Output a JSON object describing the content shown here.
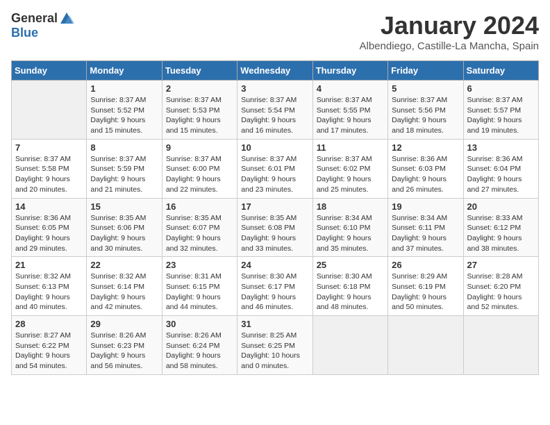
{
  "header": {
    "logo_general": "General",
    "logo_blue": "Blue",
    "title": "January 2024",
    "subtitle": "Albendiego, Castille-La Mancha, Spain"
  },
  "weekdays": [
    "Sunday",
    "Monday",
    "Tuesday",
    "Wednesday",
    "Thursday",
    "Friday",
    "Saturday"
  ],
  "weeks": [
    [
      {
        "day": "",
        "empty": true
      },
      {
        "day": "1",
        "sunrise": "Sunrise: 8:37 AM",
        "sunset": "Sunset: 5:52 PM",
        "daylight": "Daylight: 9 hours and 15 minutes."
      },
      {
        "day": "2",
        "sunrise": "Sunrise: 8:37 AM",
        "sunset": "Sunset: 5:53 PM",
        "daylight": "Daylight: 9 hours and 15 minutes."
      },
      {
        "day": "3",
        "sunrise": "Sunrise: 8:37 AM",
        "sunset": "Sunset: 5:54 PM",
        "daylight": "Daylight: 9 hours and 16 minutes."
      },
      {
        "day": "4",
        "sunrise": "Sunrise: 8:37 AM",
        "sunset": "Sunset: 5:55 PM",
        "daylight": "Daylight: 9 hours and 17 minutes."
      },
      {
        "day": "5",
        "sunrise": "Sunrise: 8:37 AM",
        "sunset": "Sunset: 5:56 PM",
        "daylight": "Daylight: 9 hours and 18 minutes."
      },
      {
        "day": "6",
        "sunrise": "Sunrise: 8:37 AM",
        "sunset": "Sunset: 5:57 PM",
        "daylight": "Daylight: 9 hours and 19 minutes."
      }
    ],
    [
      {
        "day": "7",
        "sunrise": "Sunrise: 8:37 AM",
        "sunset": "Sunset: 5:58 PM",
        "daylight": "Daylight: 9 hours and 20 minutes."
      },
      {
        "day": "8",
        "sunrise": "Sunrise: 8:37 AM",
        "sunset": "Sunset: 5:59 PM",
        "daylight": "Daylight: 9 hours and 21 minutes."
      },
      {
        "day": "9",
        "sunrise": "Sunrise: 8:37 AM",
        "sunset": "Sunset: 6:00 PM",
        "daylight": "Daylight: 9 hours and 22 minutes."
      },
      {
        "day": "10",
        "sunrise": "Sunrise: 8:37 AM",
        "sunset": "Sunset: 6:01 PM",
        "daylight": "Daylight: 9 hours and 23 minutes."
      },
      {
        "day": "11",
        "sunrise": "Sunrise: 8:37 AM",
        "sunset": "Sunset: 6:02 PM",
        "daylight": "Daylight: 9 hours and 25 minutes."
      },
      {
        "day": "12",
        "sunrise": "Sunrise: 8:36 AM",
        "sunset": "Sunset: 6:03 PM",
        "daylight": "Daylight: 9 hours and 26 minutes."
      },
      {
        "day": "13",
        "sunrise": "Sunrise: 8:36 AM",
        "sunset": "Sunset: 6:04 PM",
        "daylight": "Daylight: 9 hours and 27 minutes."
      }
    ],
    [
      {
        "day": "14",
        "sunrise": "Sunrise: 8:36 AM",
        "sunset": "Sunset: 6:05 PM",
        "daylight": "Daylight: 9 hours and 29 minutes."
      },
      {
        "day": "15",
        "sunrise": "Sunrise: 8:35 AM",
        "sunset": "Sunset: 6:06 PM",
        "daylight": "Daylight: 9 hours and 30 minutes."
      },
      {
        "day": "16",
        "sunrise": "Sunrise: 8:35 AM",
        "sunset": "Sunset: 6:07 PM",
        "daylight": "Daylight: 9 hours and 32 minutes."
      },
      {
        "day": "17",
        "sunrise": "Sunrise: 8:35 AM",
        "sunset": "Sunset: 6:08 PM",
        "daylight": "Daylight: 9 hours and 33 minutes."
      },
      {
        "day": "18",
        "sunrise": "Sunrise: 8:34 AM",
        "sunset": "Sunset: 6:10 PM",
        "daylight": "Daylight: 9 hours and 35 minutes."
      },
      {
        "day": "19",
        "sunrise": "Sunrise: 8:34 AM",
        "sunset": "Sunset: 6:11 PM",
        "daylight": "Daylight: 9 hours and 37 minutes."
      },
      {
        "day": "20",
        "sunrise": "Sunrise: 8:33 AM",
        "sunset": "Sunset: 6:12 PM",
        "daylight": "Daylight: 9 hours and 38 minutes."
      }
    ],
    [
      {
        "day": "21",
        "sunrise": "Sunrise: 8:32 AM",
        "sunset": "Sunset: 6:13 PM",
        "daylight": "Daylight: 9 hours and 40 minutes."
      },
      {
        "day": "22",
        "sunrise": "Sunrise: 8:32 AM",
        "sunset": "Sunset: 6:14 PM",
        "daylight": "Daylight: 9 hours and 42 minutes."
      },
      {
        "day": "23",
        "sunrise": "Sunrise: 8:31 AM",
        "sunset": "Sunset: 6:15 PM",
        "daylight": "Daylight: 9 hours and 44 minutes."
      },
      {
        "day": "24",
        "sunrise": "Sunrise: 8:30 AM",
        "sunset": "Sunset: 6:17 PM",
        "daylight": "Daylight: 9 hours and 46 minutes."
      },
      {
        "day": "25",
        "sunrise": "Sunrise: 8:30 AM",
        "sunset": "Sunset: 6:18 PM",
        "daylight": "Daylight: 9 hours and 48 minutes."
      },
      {
        "day": "26",
        "sunrise": "Sunrise: 8:29 AM",
        "sunset": "Sunset: 6:19 PM",
        "daylight": "Daylight: 9 hours and 50 minutes."
      },
      {
        "day": "27",
        "sunrise": "Sunrise: 8:28 AM",
        "sunset": "Sunset: 6:20 PM",
        "daylight": "Daylight: 9 hours and 52 minutes."
      }
    ],
    [
      {
        "day": "28",
        "sunrise": "Sunrise: 8:27 AM",
        "sunset": "Sunset: 6:22 PM",
        "daylight": "Daylight: 9 hours and 54 minutes."
      },
      {
        "day": "29",
        "sunrise": "Sunrise: 8:26 AM",
        "sunset": "Sunset: 6:23 PM",
        "daylight": "Daylight: 9 hours and 56 minutes."
      },
      {
        "day": "30",
        "sunrise": "Sunrise: 8:26 AM",
        "sunset": "Sunset: 6:24 PM",
        "daylight": "Daylight: 9 hours and 58 minutes."
      },
      {
        "day": "31",
        "sunrise": "Sunrise: 8:25 AM",
        "sunset": "Sunset: 6:25 PM",
        "daylight": "Daylight: 10 hours and 0 minutes."
      },
      {
        "day": "",
        "empty": true
      },
      {
        "day": "",
        "empty": true
      },
      {
        "day": "",
        "empty": true
      }
    ]
  ]
}
